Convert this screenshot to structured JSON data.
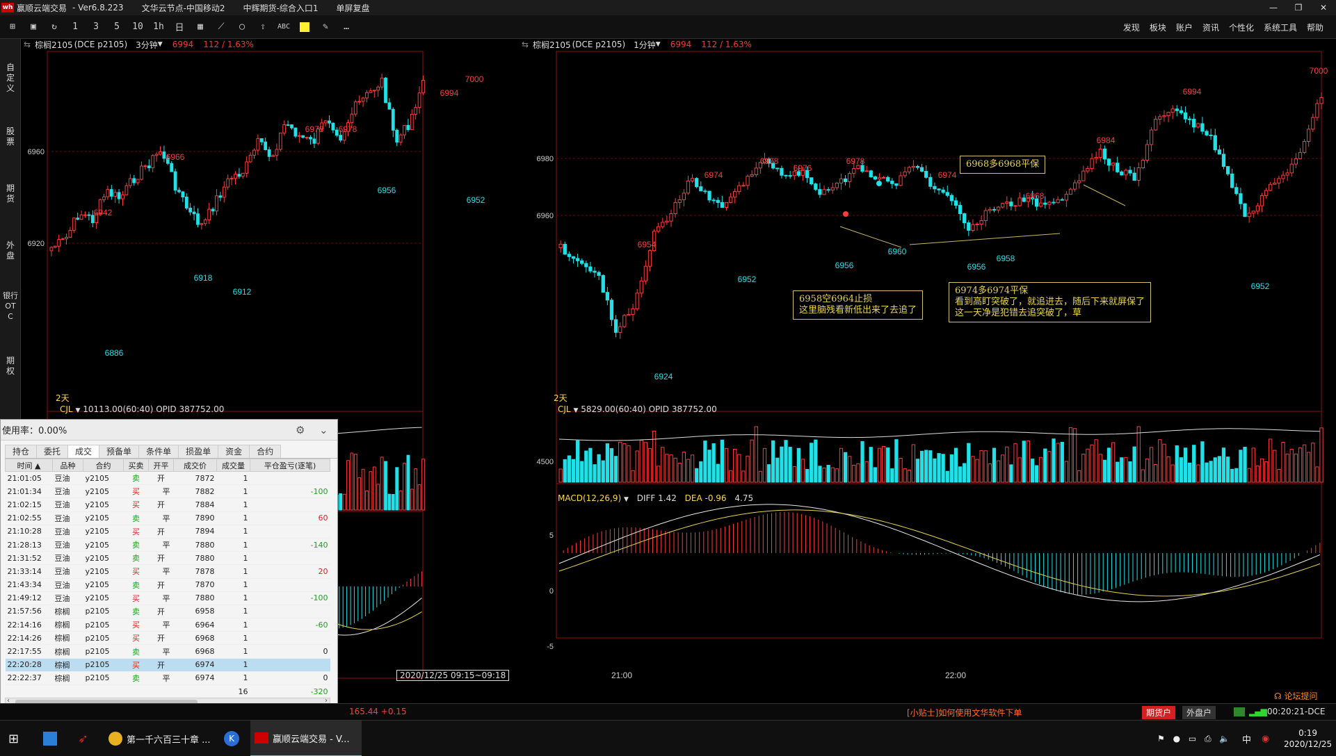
{
  "titlebar": {
    "app_title": "赢顺云端交易",
    "version": "- Ver6.8.223",
    "server": "文华云节点-中国移动2",
    "channel": "中辉期货-综合入口1",
    "mode": "单屏复盘",
    "min": "—",
    "restore": "❐",
    "close": "✕"
  },
  "toolbar": {
    "icons": [
      "⊞",
      "▣",
      "↻",
      "1",
      "3",
      "5",
      "10",
      "1h",
      "日",
      "▦",
      "⟋",
      "◯",
      "⇧",
      "ABC",
      "■",
      "✎",
      "…"
    ],
    "menus": [
      "发现",
      "板块",
      "账户",
      "资讯",
      "个性化",
      "系统工具",
      "帮助"
    ]
  },
  "sidebar": [
    "自定义",
    "股票",
    "期货",
    "外盘",
    "银行OTC",
    "期权"
  ],
  "left_chart": {
    "name": "棕榈2105",
    "code": "(DCE p2105)",
    "period": "3分钟",
    "price": "6994",
    "change": "112 / 1.63%",
    "days": "2天",
    "vol_label": "CJL",
    "vol_info": "10113.00(60:40)  OPID 387752.00",
    "date_range": "2020/12/25 09:15~09:18"
  },
  "right_chart": {
    "name": "棕榈2105",
    "code": "(DCE p2105)",
    "period": "1分钟",
    "price": "6994",
    "change": "112 / 1.63%",
    "days": "2天",
    "vol_label": "CJL",
    "vol_info": "5829.00(60:40)  OPID 387752.00",
    "macd_label": "MACD(12,26,9)",
    "diff": "DIFF 1.42",
    "dea": "DEA -0.96",
    "macd_val": "4.75",
    "time_labels": [
      "21:00",
      "22:00"
    ]
  },
  "left_price_labels": {
    "axis": [
      "6960",
      "6920"
    ],
    "highs": [
      "7000",
      "6994",
      "6978",
      "6978",
      "6966",
      "6942"
    ],
    "lows": [
      "6956",
      "6952",
      "6918",
      "6912",
      "6886"
    ]
  },
  "right_price_labels": {
    "axis": [
      "6980",
      "6960"
    ],
    "vol_axis": "4500",
    "macd_axis": [
      "5",
      "0",
      "-5"
    ],
    "highs": [
      "7000",
      "6994",
      "6984",
      "6978",
      "6978",
      "6976",
      "6974",
      "6974",
      "6968",
      "6954"
    ],
    "lows": [
      "6956",
      "6952",
      "6956",
      "6960",
      "6958",
      "6952",
      "6924"
    ]
  },
  "annotations": {
    "a1": "6968多6968平保",
    "a2_line1": "6958空6964止损",
    "a2_line2": "这里脑残看新低出来了去追了",
    "a3_line1": "6974多6974平保",
    "a3_line2": "看到高盯突破了，就追进去，随后下来就屏保了",
    "a3_line3": "这一天净是犯错去追突破了，草"
  },
  "trade_panel": {
    "usage": "使用率：0.00%",
    "tabs": [
      "持仓",
      "委托",
      "成交",
      "预备单",
      "条件单",
      "损盈单",
      "资金",
      "合约"
    ],
    "columns": [
      "时间",
      "品种",
      "合约",
      "买卖",
      "开平",
      "成交价",
      "成交量",
      "平仓盈亏(逐笔)"
    ],
    "rows": [
      [
        "21:01:05",
        "豆油",
        "y2105",
        "卖",
        "开",
        "7872",
        "1",
        ""
      ],
      [
        "21:01:34",
        "豆油",
        "y2105",
        "买",
        "平",
        "7882",
        "1",
        "-100"
      ],
      [
        "21:02:15",
        "豆油",
        "y2105",
        "买",
        "开",
        "7884",
        "1",
        ""
      ],
      [
        "21:02:55",
        "豆油",
        "y2105",
        "卖",
        "平",
        "7890",
        "1",
        "60"
      ],
      [
        "21:10:28",
        "豆油",
        "y2105",
        "买",
        "开",
        "7894",
        "1",
        ""
      ],
      [
        "21:28:13",
        "豆油",
        "y2105",
        "卖",
        "平",
        "7880",
        "1",
        "-140"
      ],
      [
        "21:31:52",
        "豆油",
        "y2105",
        "卖",
        "开",
        "7880",
        "1",
        ""
      ],
      [
        "21:33:14",
        "豆油",
        "y2105",
        "买",
        "平",
        "7878",
        "1",
        "20"
      ],
      [
        "21:43:34",
        "豆油",
        "y2105",
        "卖",
        "开",
        "7870",
        "1",
        ""
      ],
      [
        "21:49:12",
        "豆油",
        "y2105",
        "买",
        "平",
        "7880",
        "1",
        "-100"
      ],
      [
        "21:57:56",
        "棕榈",
        "p2105",
        "卖",
        "开",
        "6958",
        "1",
        ""
      ],
      [
        "22:14:16",
        "棕榈",
        "p2105",
        "买",
        "平",
        "6964",
        "1",
        "-60"
      ],
      [
        "22:14:26",
        "棕榈",
        "p2105",
        "买",
        "开",
        "6968",
        "1",
        ""
      ],
      [
        "22:17:55",
        "棕榈",
        "p2105",
        "卖",
        "平",
        "6968",
        "1",
        "0"
      ],
      [
        "22:20:28",
        "棕榈",
        "p2105",
        "买",
        "开",
        "6974",
        "1",
        ""
      ],
      [
        "22:22:37",
        "棕榈",
        "p2105",
        "卖",
        "平",
        "6974",
        "1",
        "0"
      ]
    ],
    "total_volume": "16",
    "total_pnl": "-320",
    "selected_row": 14
  },
  "statusbar": {
    "quote": "165.44  +0.15",
    "tip": "[小贴士]如何使用文华软件下单",
    "futures_acct": "期货户",
    "foreign_acct": "外盘户",
    "clock": "00:20:21-DCE",
    "forum": "论坛提问"
  },
  "taskbar": {
    "item1": "第一千六百三十章 ...",
    "item2": "赢顺云端交易 - V...",
    "time": "0:19",
    "date": "2020/12/25",
    "ime": "中"
  },
  "colors": {
    "up": "#ff3b3b",
    "down": "#22e0e8",
    "bg": "#000000"
  }
}
